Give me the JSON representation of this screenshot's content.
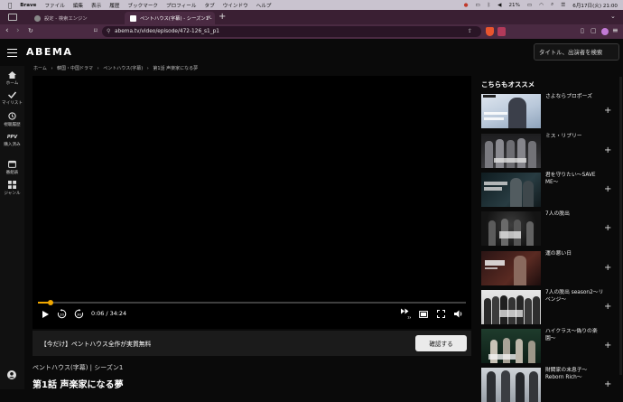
{
  "menubar": {
    "items": [
      "Brave",
      "ファイル",
      "編集",
      "表示",
      "履歴",
      "ブックマーク",
      "プロフィール",
      "タブ",
      "ウインドウ",
      "ヘルプ"
    ],
    "battery": "21%",
    "datetime": "6月17日(火) 21:00"
  },
  "browser": {
    "tabs": [
      {
        "label": "設定 - 検索エンジン",
        "active": false
      },
      {
        "label": "ペントハウス(字幕) - シーズン1 -",
        "active": true
      }
    ],
    "url": "abema.tv/video/episode/472-126_s1_p1"
  },
  "header": {
    "logo": "ABEMA",
    "search_placeholder": "タイトル、出演者を検索"
  },
  "rail": {
    "items": [
      {
        "label": "ホーム",
        "icon": "home-icon"
      },
      {
        "label": "マイリスト",
        "icon": "check-icon"
      },
      {
        "label": "視聴履歴",
        "icon": "history-icon"
      },
      {
        "label": "購入済み",
        "icon": "ppv-icon",
        "badge": "PPV"
      },
      {
        "label": "番組表",
        "icon": "calendar-icon"
      },
      {
        "label": "ジャンル",
        "icon": "grid-icon"
      }
    ]
  },
  "breadcrumb": [
    "ホーム",
    "›",
    "韓国・中国ドラマ",
    "›",
    "ペントハウス(字幕)",
    "›",
    "第1話 声楽家になる夢"
  ],
  "player": {
    "progress": 0.029,
    "current_time": "0:06",
    "separator": "/",
    "duration": "34:24",
    "skip_back_label": "10",
    "skip_fwd_label": "30",
    "speed_label": "1x"
  },
  "promo": {
    "text": "【今だけ】ペントハウス全作が実質無料",
    "button": "確認する"
  },
  "series_line": "ペントハウス(字幕) | シーズン1",
  "episode_title": "第1話 声楽家になる夢",
  "recommendations": {
    "heading": "こちらもオススメ",
    "items": [
      {
        "title": "さよならプロポーズ"
      },
      {
        "title": "ミス・リプリー"
      },
      {
        "title": "君を守りたい〜SAVE ME〜"
      },
      {
        "title": "7人の脱出"
      },
      {
        "title": "運の悪い日"
      },
      {
        "title": "7人の脱出 season2〜リベンジ〜"
      },
      {
        "title": "ハイクラス〜偽りの楽園〜"
      },
      {
        "title": "財閥家の末息子〜Reborn Rich〜"
      }
    ]
  },
  "colors": {
    "accent": "#f0a700",
    "page_bg": "#0a0a0a",
    "browser_chrome": "#4a2a42"
  }
}
